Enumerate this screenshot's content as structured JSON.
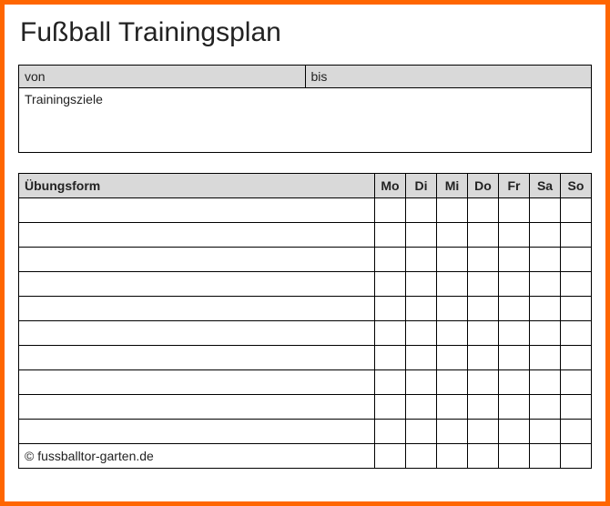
{
  "title": "Fußball Trainingsplan",
  "period": {
    "from_label": "von",
    "to_label": "bis"
  },
  "goals_label": "Trainingsziele",
  "schedule": {
    "exercise_header": "Übungsform",
    "days": [
      "Mo",
      "Di",
      "Mi",
      "Do",
      "Fr",
      "Sa",
      "So"
    ]
  },
  "copyright": "© fussballtor-garten.de"
}
